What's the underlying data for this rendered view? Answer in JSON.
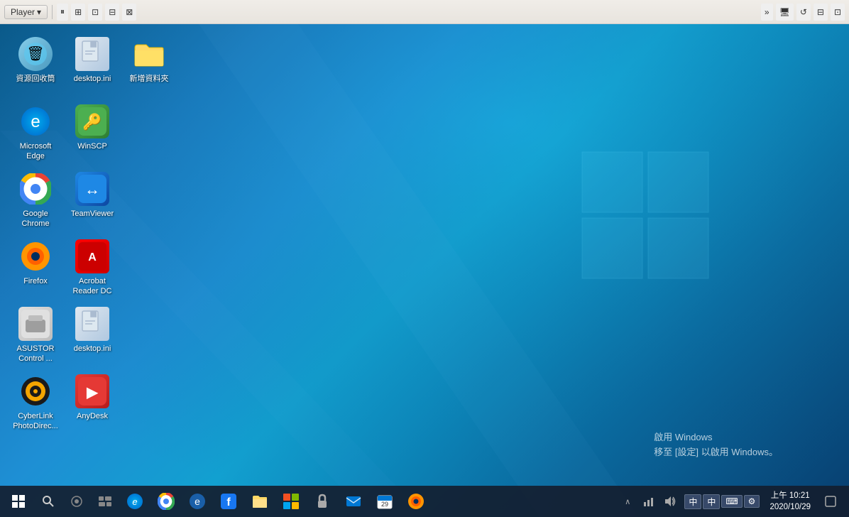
{
  "vmware": {
    "toolbar": {
      "player_label": "Player",
      "dropdown_arrow": "▾"
    }
  },
  "desktop": {
    "icons": [
      {
        "id": "recycle-bin",
        "label": "資源回收筒",
        "icon_type": "recycle",
        "emoji": "🗑"
      },
      {
        "id": "desktop-ini-1",
        "label": "desktop.ini",
        "icon_type": "desktop-ini",
        "emoji": "📄"
      },
      {
        "id": "new-folder",
        "label": "新增資料夾",
        "icon_type": "folder",
        "emoji": "📁"
      },
      {
        "id": "microsoft-edge",
        "label": "Microsoft Edge",
        "icon_type": "edge",
        "emoji": "🌐"
      },
      {
        "id": "winscp",
        "label": "WinSCP",
        "icon_type": "winscp",
        "emoji": "🔐"
      },
      {
        "id": "empty1",
        "label": "",
        "icon_type": "empty",
        "emoji": ""
      },
      {
        "id": "google-chrome",
        "label": "Google Chrome",
        "icon_type": "chrome",
        "emoji": "🔵"
      },
      {
        "id": "teamviewer",
        "label": "TeamViewer",
        "icon_type": "teamviewer",
        "emoji": "↔"
      },
      {
        "id": "empty2",
        "label": "",
        "icon_type": "empty",
        "emoji": ""
      },
      {
        "id": "firefox",
        "label": "Firefox",
        "icon_type": "firefox",
        "emoji": "🦊"
      },
      {
        "id": "acrobat",
        "label": "Acrobat Reader DC",
        "icon_type": "acrobat",
        "emoji": "📕"
      },
      {
        "id": "empty3",
        "label": "",
        "icon_type": "empty",
        "emoji": ""
      },
      {
        "id": "asustor",
        "label": "ASUSTOR Control ...",
        "icon_type": "asustor",
        "emoji": "🖥"
      },
      {
        "id": "desktop-ini-2",
        "label": "desktop.ini",
        "icon_type": "desktop-ini",
        "emoji": "📄"
      },
      {
        "id": "empty4",
        "label": "",
        "icon_type": "empty",
        "emoji": ""
      },
      {
        "id": "cyberlink",
        "label": "CyberLink PhotoDirec...",
        "icon_type": "cyberlink",
        "emoji": "📷"
      },
      {
        "id": "anydesk",
        "label": "AnyDesk",
        "icon_type": "anydesk",
        "emoji": "🖥"
      }
    ],
    "activate_text": "啟用 Windows",
    "activate_subtext": "移至 [設定] 以啟用 Windows。"
  },
  "taskbar": {
    "time": "上午 10:21",
    "date": "2020/10/29",
    "apps": [
      {
        "id": "edge",
        "emoji": "🌐",
        "label": "Microsoft Edge"
      },
      {
        "id": "chrome",
        "emoji": "🔵",
        "label": "Google Chrome"
      },
      {
        "id": "ie",
        "emoji": "🌐",
        "label": "Internet Explorer"
      },
      {
        "id": "facebook",
        "emoji": "🔷",
        "label": "Facebook"
      },
      {
        "id": "files",
        "emoji": "📁",
        "label": "File Explorer"
      },
      {
        "id": "store",
        "emoji": "🛍",
        "label": "Windows Store"
      },
      {
        "id": "lock",
        "emoji": "🔒",
        "label": "Lock"
      },
      {
        "id": "email",
        "emoji": "✉",
        "label": "Mail"
      },
      {
        "id": "calendar",
        "emoji": "📅",
        "label": "Calendar"
      },
      {
        "id": "firefox",
        "emoji": "🦊",
        "label": "Firefox"
      }
    ],
    "ime": {
      "lang": "中",
      "mode1": "中",
      "mode2": "●"
    }
  }
}
